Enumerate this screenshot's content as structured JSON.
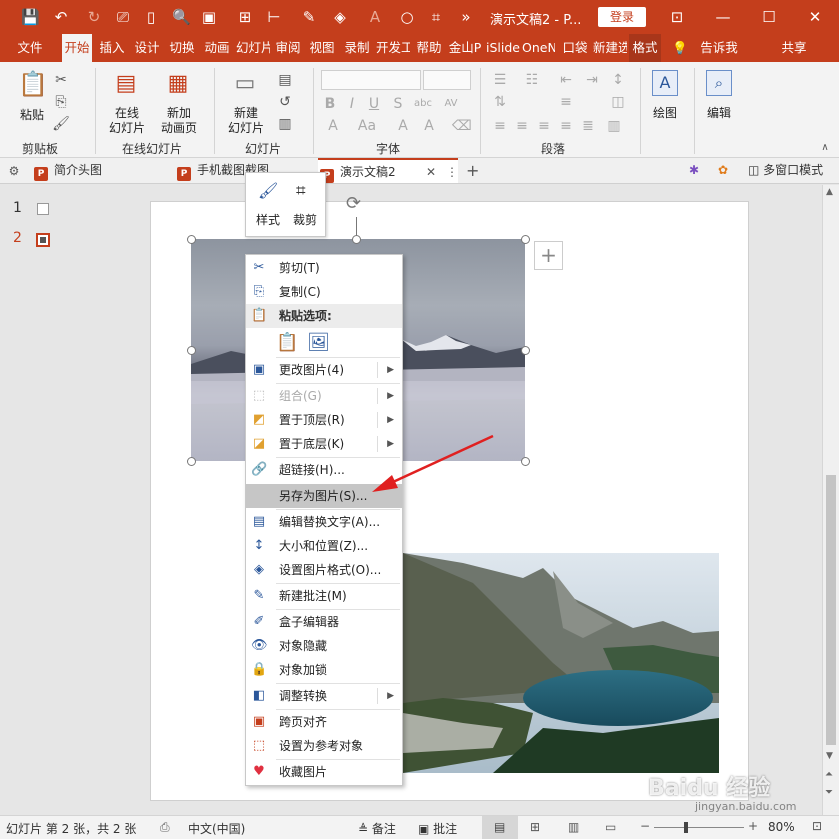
{
  "title_bar": {
    "doc_title": "演示文稿2 - P...",
    "login": "登录",
    "icons": [
      "save-icon",
      "undo-icon",
      "redo-icon",
      "present-icon",
      "new-icon",
      "print-preview-icon",
      "screenshot-icon",
      "grid-icon",
      "align-icon",
      "eyedropper-icon",
      "fill-icon",
      "font-color-icon",
      "circle-icon",
      "crop-frame-icon",
      "more-icon"
    ]
  },
  "ribbon_tabs": [
    "文件",
    "开始",
    "插入",
    "设计",
    "切换",
    "动画",
    "幻灯片",
    "审阅",
    "视图",
    "录制",
    "开发工",
    "帮助",
    "金山P",
    "iSlide",
    "OneN",
    "口袋",
    "新建选",
    "格式"
  ],
  "tell_me": "告诉我",
  "share": "共享",
  "ribbon": {
    "paste": "粘贴",
    "clipboard": "剪贴板",
    "online_slide": "在线\n幻灯片",
    "online_slide_l1": "在线",
    "online_slide_l2": "幻灯片",
    "new_anim_l1": "新加",
    "new_anim_l2": "动画页",
    "online_group": "在线幻灯片",
    "new_slide_l1": "新建",
    "new_slide_l2": "幻灯片",
    "slides_group": "幻灯片",
    "font_group": "字体",
    "para_group": "段落",
    "draw": "绘图",
    "edit": "编辑"
  },
  "doc_tabs": [
    "简介头图",
    "手机截图截图",
    "演示文稿2"
  ],
  "multi_window": "多窗口模式",
  "slides": [
    {
      "num": "1"
    },
    {
      "num": "2"
    }
  ],
  "mini_toolbar": {
    "style": "样式",
    "crop": "裁剪"
  },
  "context_menu": {
    "items": [
      {
        "label": "剪切(T)",
        "icon": "scissors-icon",
        "state": "normal"
      },
      {
        "label": "复制(C)",
        "icon": "copy-icon",
        "state": "normal"
      },
      {
        "label": "更改图片(4)",
        "icon": "change-picture-icon",
        "state": "normal",
        "arrow": true
      },
      {
        "label": "组合(G)",
        "icon": "group-icon",
        "state": "disabled",
        "arrow": true
      },
      {
        "label": "置于顶层(R)",
        "icon": "bring-front-icon",
        "state": "normal",
        "arrow": true
      },
      {
        "label": "置于底层(K)",
        "icon": "send-back-icon",
        "state": "normal",
        "arrow": true
      },
      {
        "label": "超链接(H)...",
        "icon": "link-icon",
        "state": "normal"
      },
      {
        "label": "另存为图片(S)...",
        "icon": "",
        "state": "highlighted"
      },
      {
        "label": "编辑替换文字(A)...",
        "icon": "alt-text-icon",
        "state": "normal"
      },
      {
        "label": "大小和位置(Z)...",
        "icon": "size-icon",
        "state": "normal"
      },
      {
        "label": "设置图片格式(O)...",
        "icon": "format-picture-icon",
        "state": "normal"
      },
      {
        "label": "新建批注(M)",
        "icon": "comment-icon",
        "state": "normal"
      },
      {
        "label": "盒子编辑器",
        "icon": "box-editor-icon",
        "state": "normal"
      },
      {
        "label": "对象隐藏",
        "icon": "eye-icon",
        "state": "normal"
      },
      {
        "label": "对象加锁",
        "icon": "lock-icon",
        "state": "normal"
      },
      {
        "label": "调整转换",
        "icon": "convert-icon",
        "state": "normal",
        "arrow": true
      },
      {
        "label": "跨页对齐",
        "icon": "align-pages-icon",
        "state": "normal"
      },
      {
        "label": "设置为参考对象",
        "icon": "reference-icon",
        "state": "normal"
      },
      {
        "label": "收藏图片",
        "icon": "heart-icon",
        "state": "normal"
      }
    ],
    "paste_header": "粘贴选项:"
  },
  "status_bar": {
    "slide_info": "幻灯片 第 2 张，共 2 张",
    "language": "中文(中国)",
    "notes": "备注",
    "comments": "批注",
    "zoom": "80%"
  },
  "watermark": "Baidu 经验",
  "watermark_url": "jingyan.baidu.com",
  "colors": {
    "accent": "#c43e1c",
    "ribbon_bg": "#f3f3f3",
    "menu_hl": "#c6c6c6",
    "arrow": "#e02020"
  }
}
